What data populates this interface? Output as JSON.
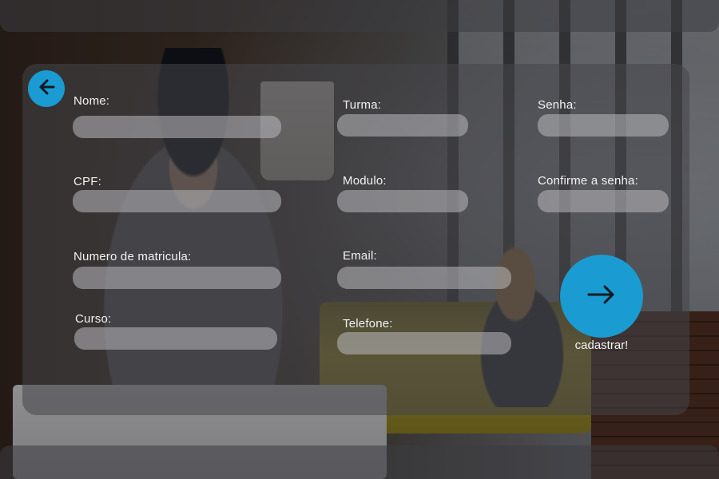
{
  "form": {
    "fields": [
      {
        "key": "nome",
        "label": "Nome:",
        "value": "",
        "placeholder": ""
      },
      {
        "key": "cpf",
        "label": "CPF:",
        "value": "",
        "placeholder": ""
      },
      {
        "key": "matricula",
        "label": "Numero de matricula:",
        "value": "",
        "placeholder": ""
      },
      {
        "key": "curso",
        "label": "Curso:",
        "value": "",
        "placeholder": ""
      },
      {
        "key": "turma",
        "label": "Turma:",
        "value": "",
        "placeholder": ""
      },
      {
        "key": "modulo",
        "label": "Modulo:",
        "value": "",
        "placeholder": ""
      },
      {
        "key": "email",
        "label": "Email:",
        "value": "",
        "placeholder": ""
      },
      {
        "key": "telefone",
        "label": "Telefone:",
        "value": "",
        "placeholder": ""
      },
      {
        "key": "senha",
        "label": "Senha:",
        "value": "",
        "placeholder": ""
      },
      {
        "key": "confirme",
        "label": "Confirme a senha:",
        "value": "",
        "placeholder": ""
      }
    ],
    "submit_label": "cadastrar!"
  },
  "icons": {
    "back": "arrow-left-icon",
    "submit": "arrow-right-icon"
  },
  "colors": {
    "accent": "#1a9bd1",
    "field_bg": "#b9b9be",
    "text": "#f2f2f2"
  }
}
